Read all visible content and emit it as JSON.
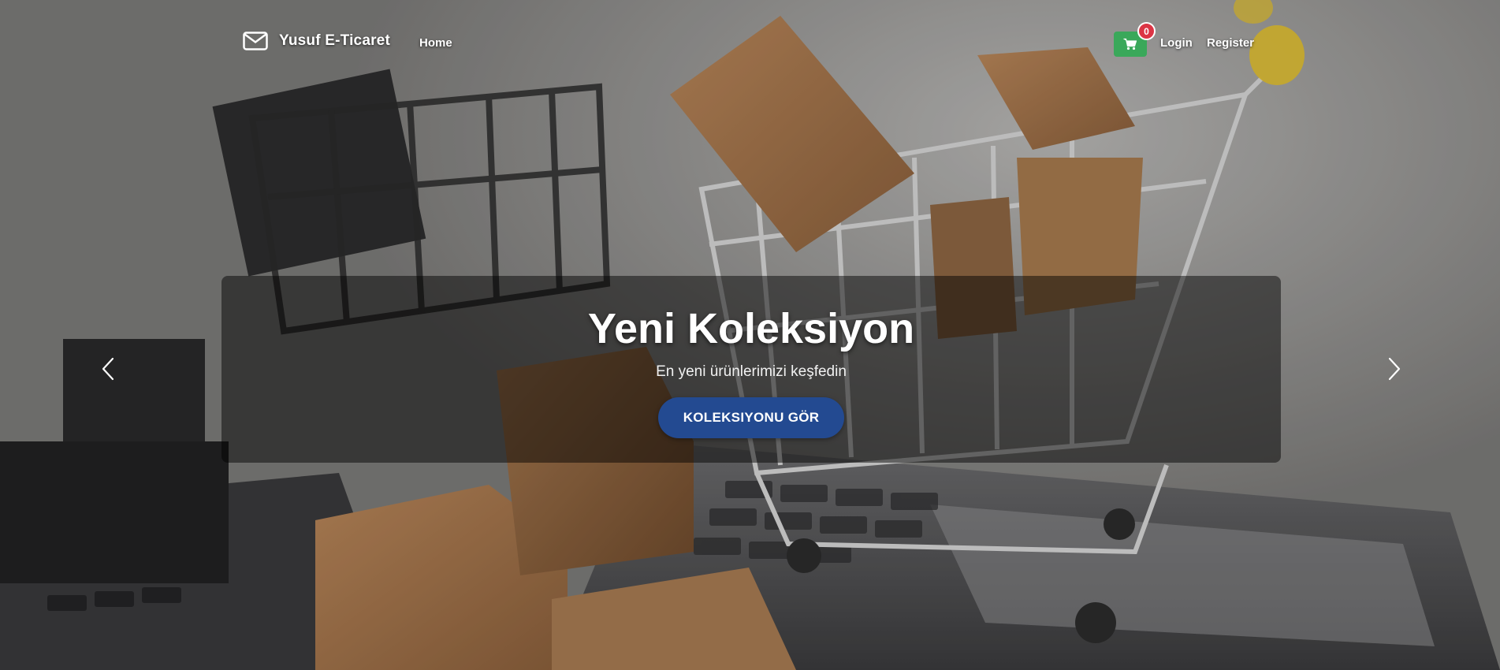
{
  "navbar": {
    "brand": "Yusuf E-Ticaret",
    "brand_icon": "envelope-icon",
    "home": "Home",
    "cart_count": "0",
    "cart_icon": "shopping-cart-icon",
    "login": "Login",
    "register": "Register"
  },
  "carousel": {
    "title": "Yeni Koleksiyon",
    "subtitle": "En yeni ürünlerimizi keşfedin",
    "button": "KOLEKSIYONU GÖR",
    "prev_icon": "chevron-left-icon",
    "next_icon": "chevron-right-icon"
  },
  "colors": {
    "cart_button": "#3aa85a",
    "badge": "#dc3545",
    "cta_button": "#234a91"
  }
}
